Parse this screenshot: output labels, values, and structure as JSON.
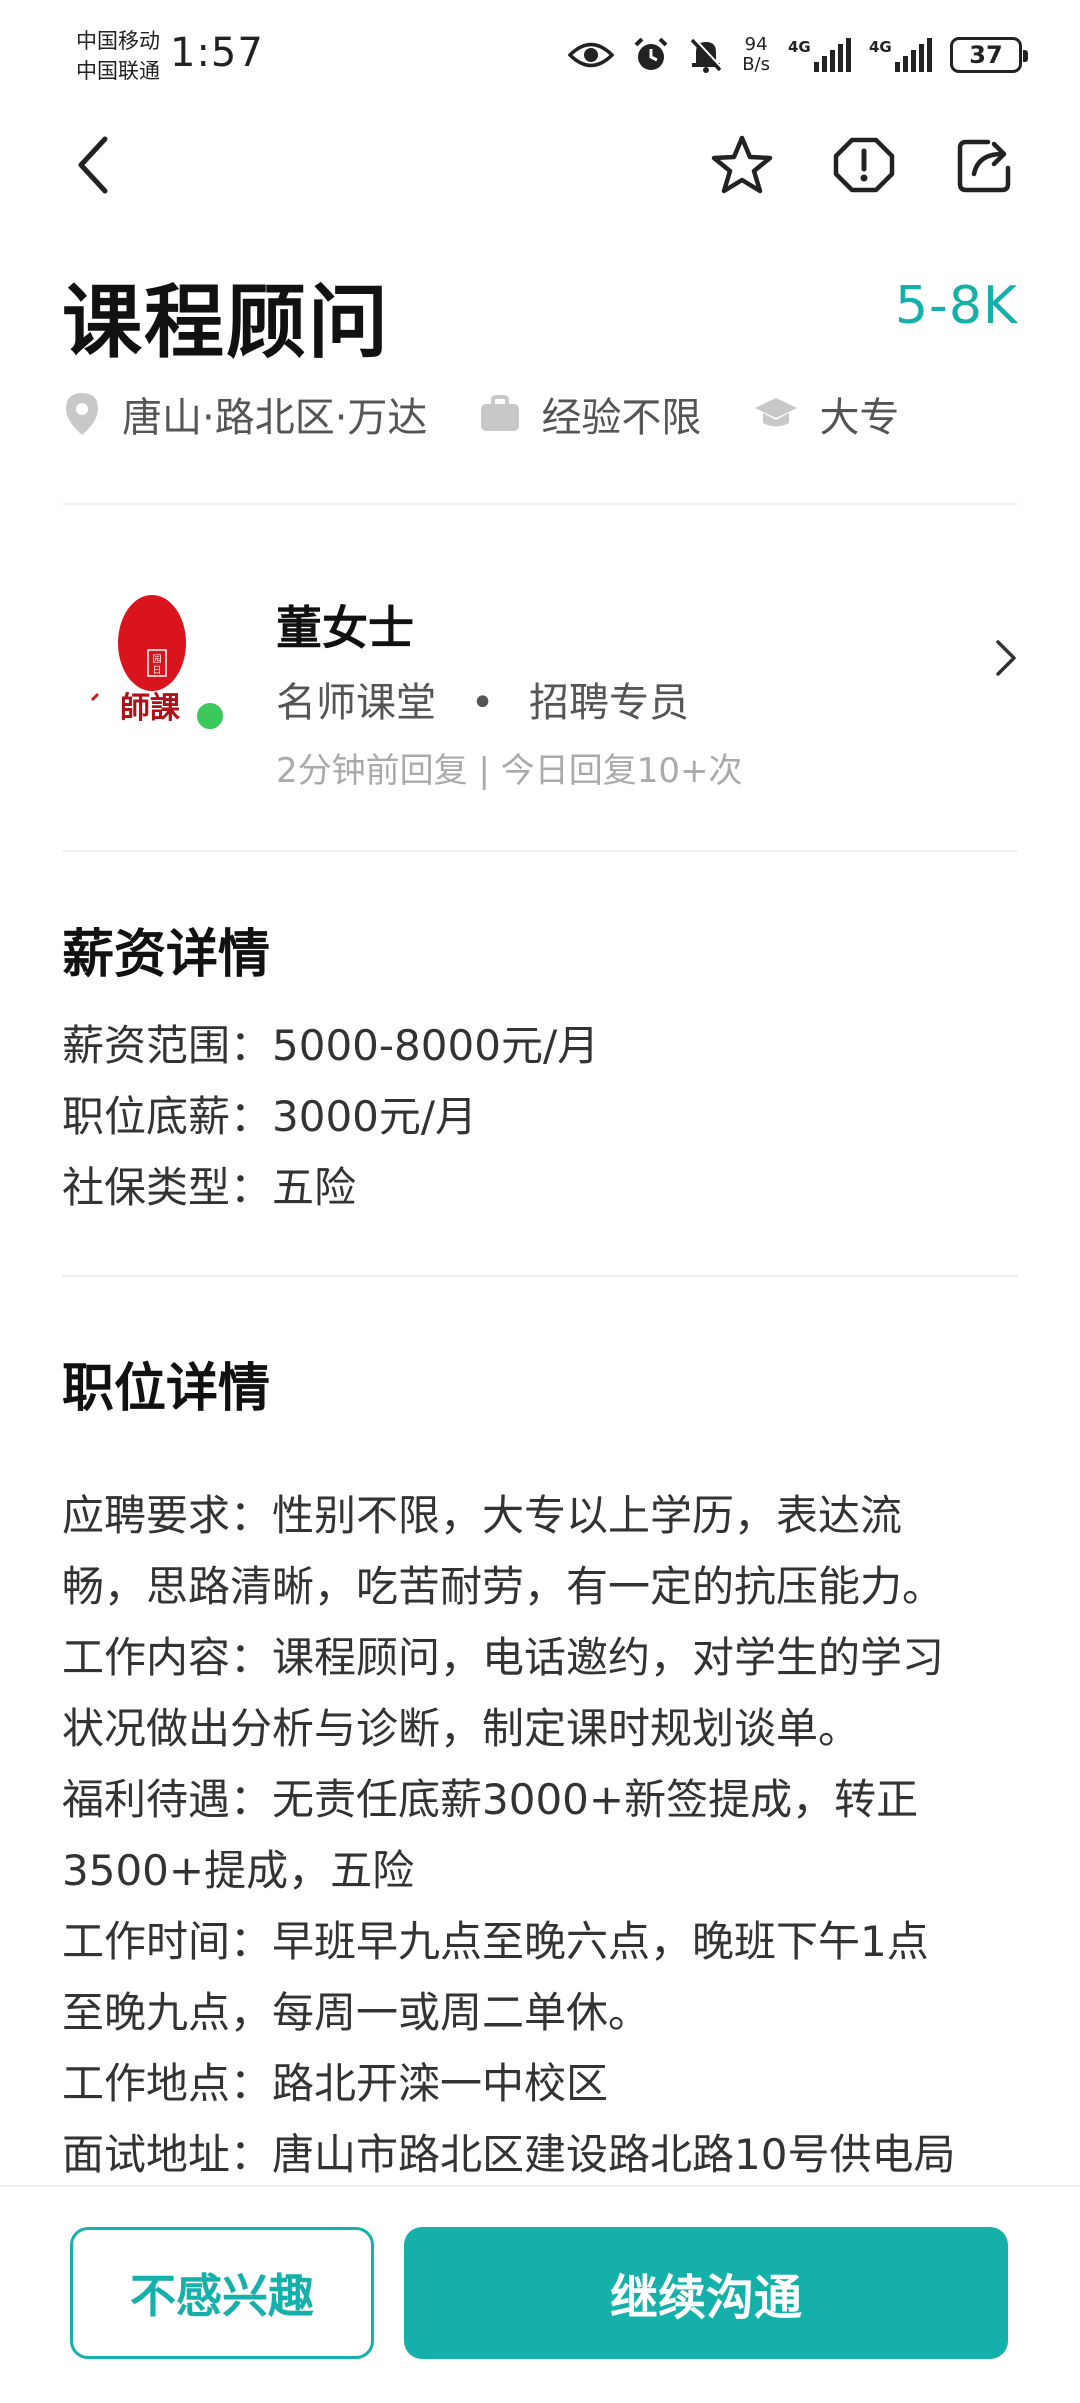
{
  "status_bar": {
    "carrier_1": "中国移动",
    "carrier_2": "中国联通",
    "time": "1:57",
    "net_speed_value": "94",
    "net_speed_unit": "B/s",
    "signal_1_label": "4G",
    "signal_2_label": "4G",
    "battery": "37",
    "icons": [
      "eye-icon",
      "alarm-icon",
      "mute-bell-icon"
    ]
  },
  "nav": {
    "icons": [
      "back-arrow-icon",
      "star-icon",
      "report-warning-icon",
      "share-icon"
    ]
  },
  "job": {
    "title": "课程顾问",
    "salary": "5-8K",
    "location": "唐山·路北区·万达",
    "experience": "经验不限",
    "education": "大专"
  },
  "recruiter": {
    "name": "董女士",
    "company": "名师课堂",
    "separator": "•",
    "role": "招聘专员",
    "reply_info": "2分钟前回复 | 今日回复10+次",
    "logo_text": "師課"
  },
  "salary_section": {
    "title": "薪资详情",
    "range_label": "薪资范围：",
    "range_value": "5000-8000元/月",
    "base_label": "职位底薪：",
    "base_value": "3000元/月",
    "insurance_label": "社保类型：",
    "insurance_value": "五险"
  },
  "job_section": {
    "title": "职位详情",
    "lines": [
      "应聘要求：性别不限，大专以上学历，表达流",
      "畅，思路清晰，吃苦耐劳，有一定的抗压能力。",
      "工作内容：课程顾问，电话邀约，对学生的学习",
      "状况做出分析与诊断，制定课时规划谈单。",
      "福利待遇：无责任底薪3000+新签提成，转正",
      "3500+提成，五险",
      "工作时间：早班早九点至晚六点，晚班下午1点",
      "至晚九点，每周一或周二单休。",
      "工作地点：路北开滦一中校区",
      "面试地址：唐山市路北区建设路北路10号供电局"
    ]
  },
  "actions": {
    "not_interested": "不感兴趣",
    "continue_chat": "继续沟通"
  },
  "colors": {
    "accent": "#15b0aa",
    "online": "#3cc85a",
    "logo_red": "#d9141c"
  }
}
